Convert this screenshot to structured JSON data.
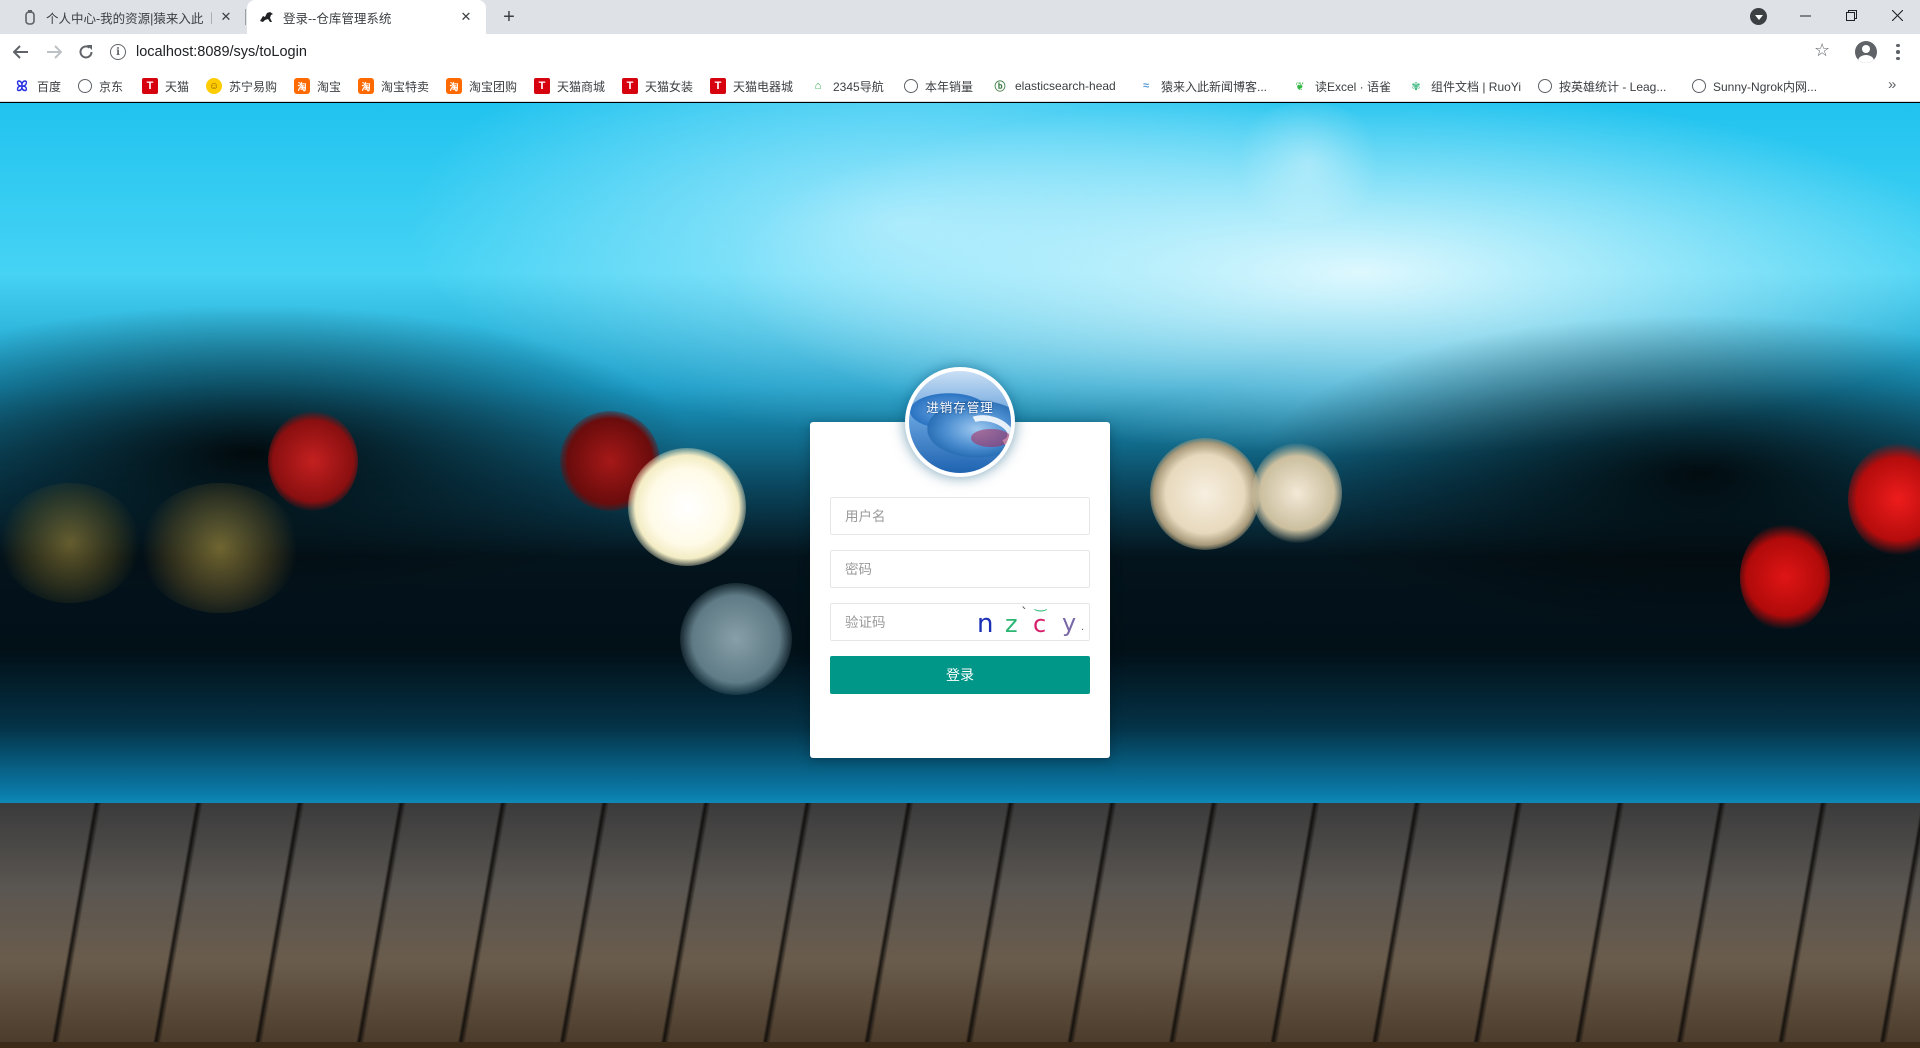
{
  "browser": {
    "tabs": [
      {
        "title": "个人中心-我的资源|猿来入此【b",
        "active": false
      },
      {
        "title": "登录--仓库管理系统",
        "active": true
      }
    ],
    "new_tab_icon": "plus-icon",
    "url": "localhost:8089/sys/toLogin",
    "bookmarks": [
      {
        "label": "百度",
        "icon": "baidu-icon"
      },
      {
        "label": "京东",
        "icon": "globe-icon"
      },
      {
        "label": "天猫",
        "icon": "tmall-icon"
      },
      {
        "label": "苏宁易购",
        "icon": "suning-icon"
      },
      {
        "label": "淘宝",
        "icon": "taobao-icon"
      },
      {
        "label": "淘宝特卖",
        "icon": "taobao-icon"
      },
      {
        "label": "淘宝团购",
        "icon": "taobao-icon"
      },
      {
        "label": "天猫商城",
        "icon": "tmall-icon"
      },
      {
        "label": "天猫女装",
        "icon": "tmall-icon"
      },
      {
        "label": "天猫电器城",
        "icon": "tmall-icon"
      },
      {
        "label": "2345导航",
        "icon": "2345-icon"
      },
      {
        "label": "本年销量",
        "icon": "globe-icon"
      },
      {
        "label": "elasticsearch-head",
        "icon": "elasticsearch-icon"
      },
      {
        "label": "猿来入此新闻博客...",
        "icon": "yuanlai-icon"
      },
      {
        "label": "读Excel · 语雀",
        "icon": "yuque-icon"
      },
      {
        "label": "组件文档 | RuoYi",
        "icon": "ruoyi-icon"
      },
      {
        "label": "按英雄统计 - Leag...",
        "icon": "globe-icon"
      },
      {
        "label": "Sunny-Ngrok内网...",
        "icon": "globe-icon"
      }
    ]
  },
  "login": {
    "logo_text": "进销存管理",
    "username_placeholder": "用户名",
    "password_placeholder": "密码",
    "captcha_placeholder": "验证码",
    "captcha_chars": [
      "n",
      "z",
      "c",
      "y"
    ],
    "captcha_colors": [
      "#1a2fb5",
      "#2bb673",
      "#d61f6a",
      "#7b68a8"
    ],
    "submit_label": "登录",
    "accent_color": "#009688"
  }
}
